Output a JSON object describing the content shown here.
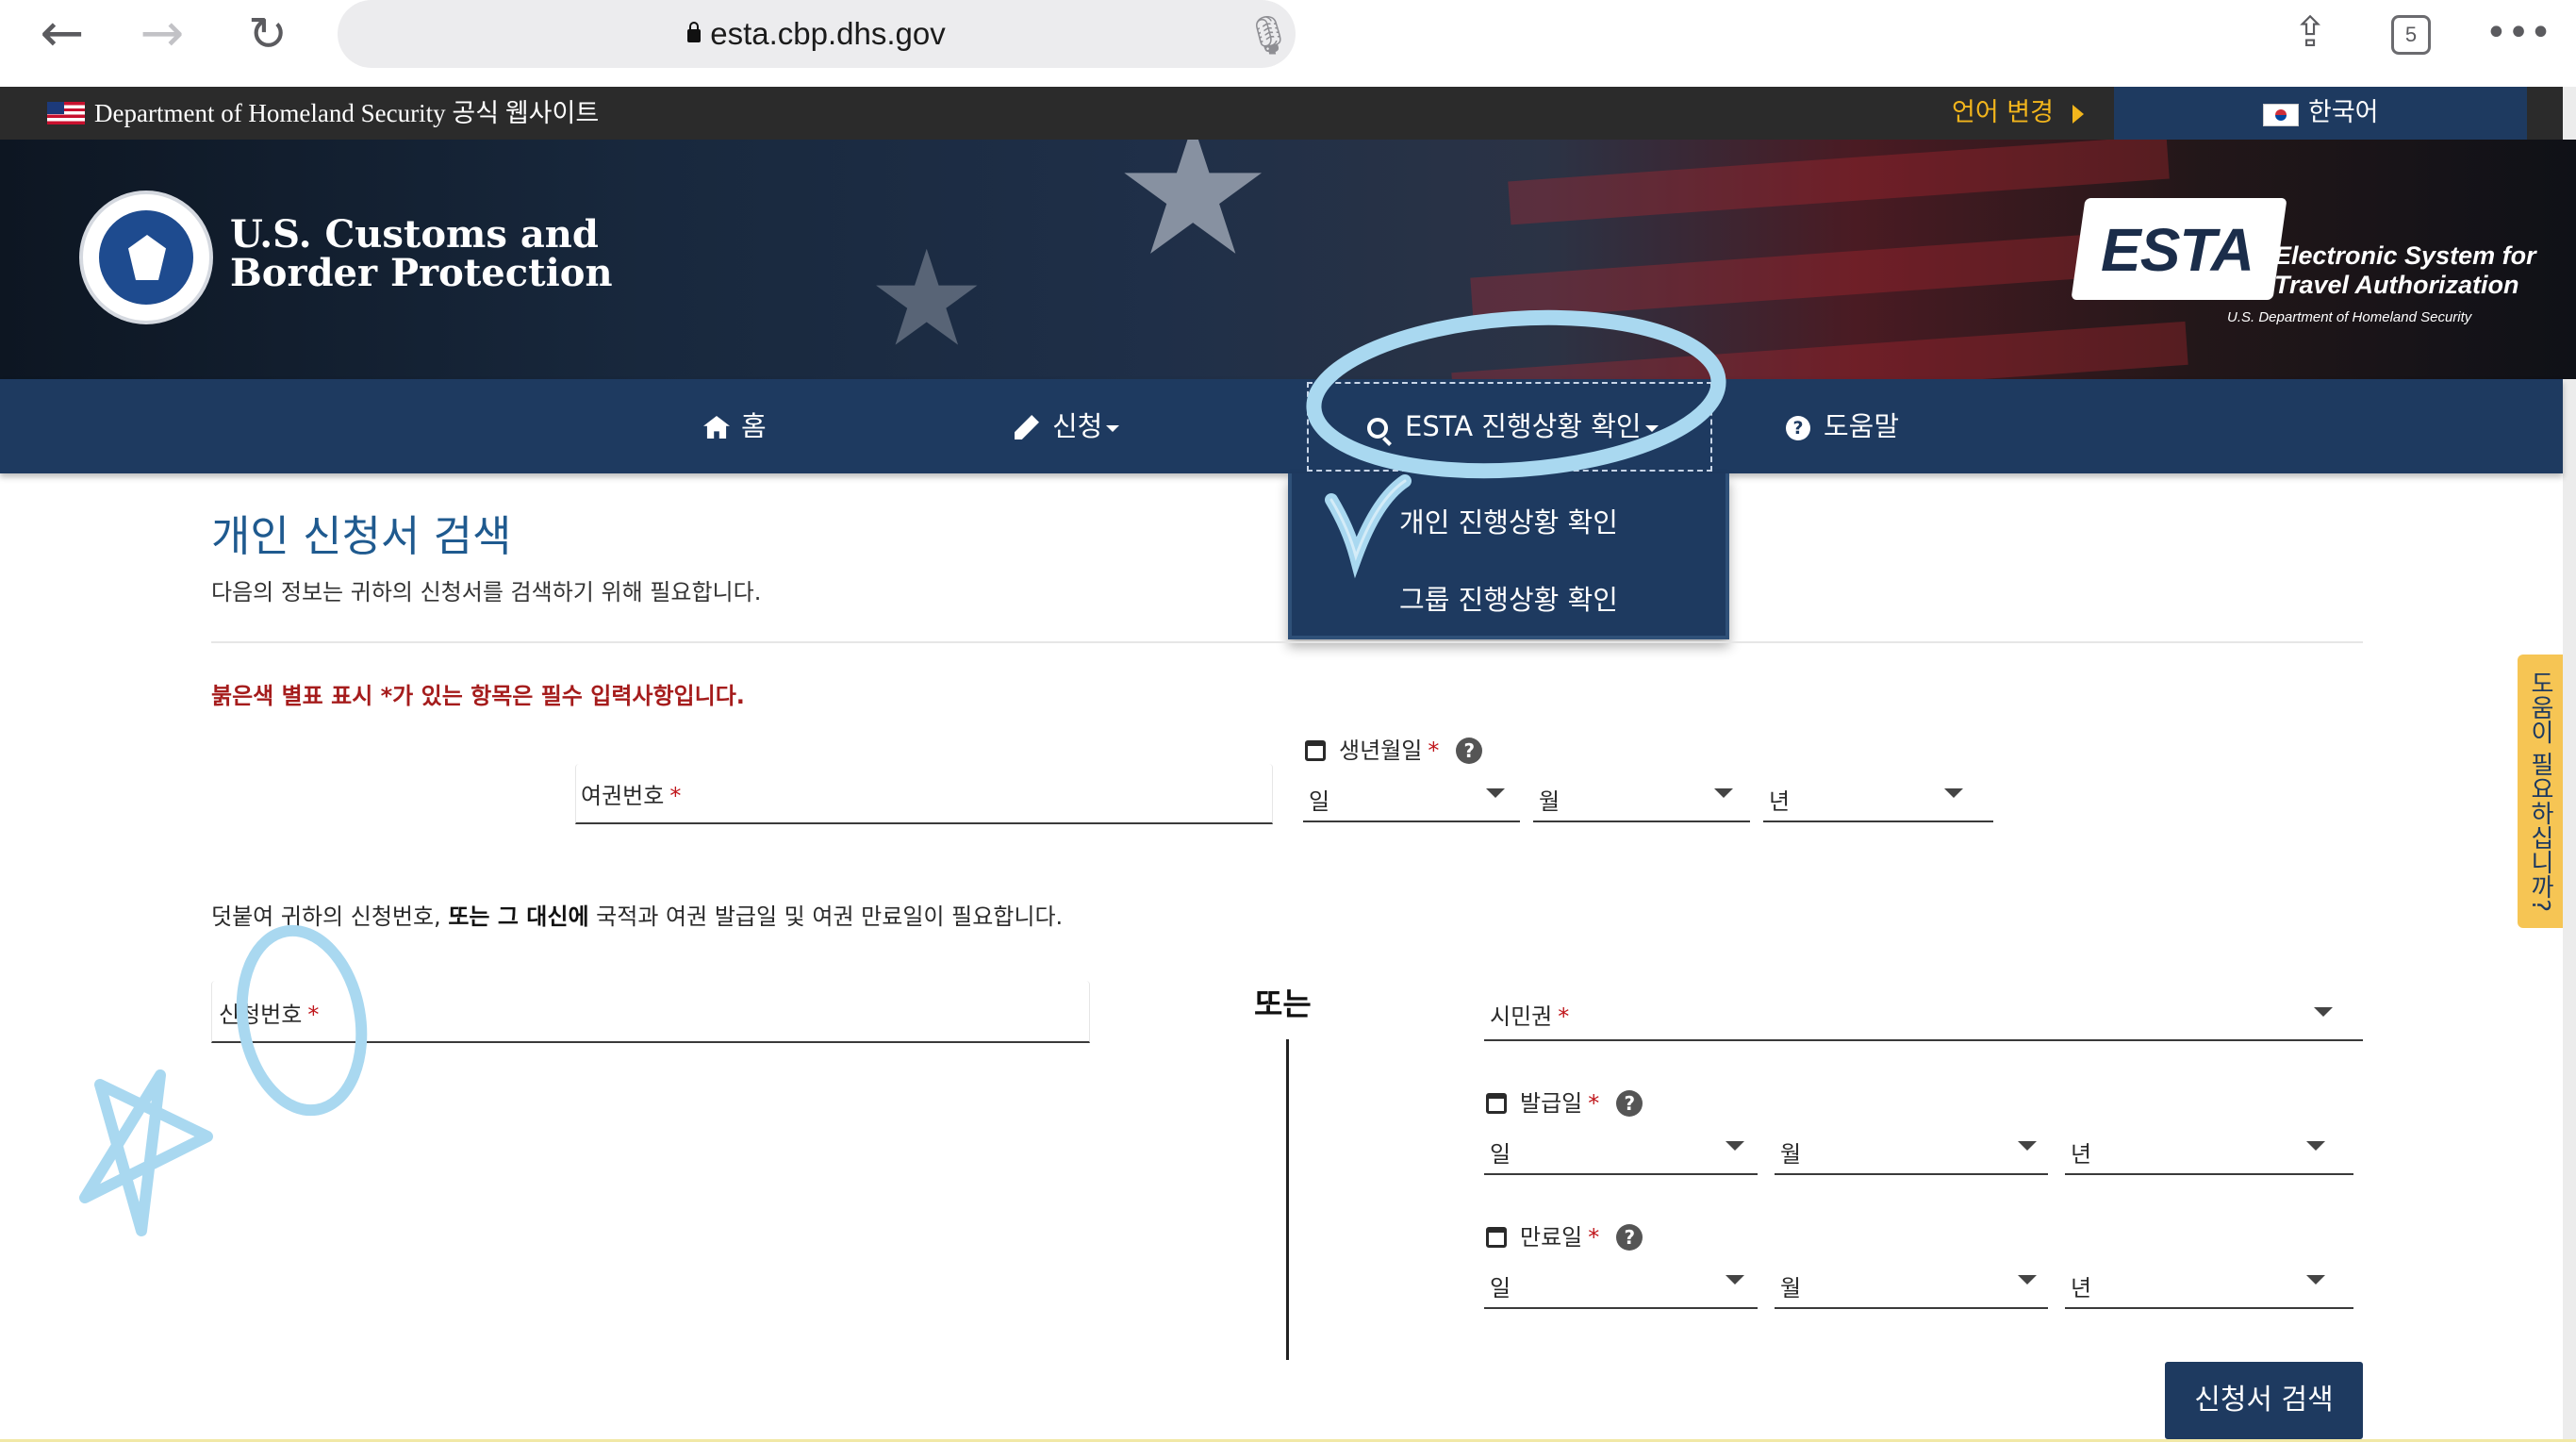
{
  "browser": {
    "url": "esta.cbp.dhs.gov",
    "tab_count": "5",
    "icons": [
      "back-icon",
      "forward-icon",
      "reload-icon",
      "lock-icon",
      "microphone-icon",
      "share-icon",
      "tabs-icon",
      "more-icon"
    ]
  },
  "gov_bar": {
    "site_notice": "Department of Homeland Security 공식 웹사이트",
    "language_change": "언어 변경",
    "current_language": "한국어"
  },
  "header": {
    "agency_line1": "U.S. Customs and",
    "agency_line2": "Border Protection",
    "esta_logo": "ESTA",
    "esta_line1": "Electronic System for",
    "esta_line2": "Travel Authorization",
    "esta_dept": "U.S. Department of Homeland Security"
  },
  "nav": {
    "home": "홈",
    "apply": "신청",
    "status": "ESTA 진행상황 확인",
    "help": "도움말"
  },
  "dropdown": {
    "items": [
      "개인 진행상황 확인",
      "그룹 진행상황 확인"
    ]
  },
  "page": {
    "title": "개인 신청서 검색",
    "description": "다음의 정보는 귀하의 신청서를 검색하기 위해 필요합니다.",
    "required_note": "붉은색 별표 표시 *가 있는 항목은 필수 입력사항입니다.",
    "passport_label": "여권번호",
    "birth_label": "생년월일",
    "day": "일",
    "month": "월",
    "year": "년",
    "info_pre": "덧붙여 귀하의 신청번호, ",
    "info_bold": "또는 그 대신에",
    "info_post": " 국적과 여권 발급일 및 여권 만료일이 필요합니다.",
    "application_label": "신청번호",
    "or": "또는",
    "citizenship_label": "시민권",
    "issue_label": "발급일",
    "expiry_label": "만료일",
    "search_button": "신청서 검색",
    "required_mark": "*",
    "help_tab": "도움이 필요하십니까?"
  },
  "colors": {
    "nav_bg": "#1e3a60",
    "title": "#1f5a8f",
    "required": "#a51c1c",
    "language_change": "#f2b51c",
    "help_tab": "#f6c554",
    "annotation": "#a9d8f0"
  }
}
